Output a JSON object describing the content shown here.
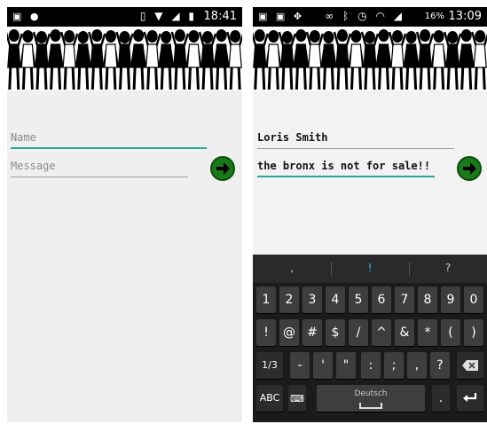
{
  "left_screen": {
    "status_time": "18:41",
    "name_placeholder": "Name",
    "message_placeholder": "Message"
  },
  "right_screen": {
    "status_time": "13:09",
    "battery_percent": "16%",
    "name_value": "Loris Smith",
    "message_value": "the bronx is not for sale!!"
  },
  "keyboard": {
    "suggestions": [
      ",",
      "!",
      "?"
    ],
    "row1": [
      "1",
      "2",
      "3",
      "4",
      "5",
      "6",
      "7",
      "8",
      "9",
      "0"
    ],
    "row2": [
      "!",
      "@",
      "#",
      "$",
      "/",
      "^",
      "&",
      "*",
      "(",
      ")"
    ],
    "row3": [
      "1/3",
      "-",
      "'",
      "\"",
      ":",
      ";",
      ",",
      "?"
    ],
    "row4_abc": "ABC",
    "row4_space": "Deutsch",
    "row4_dot": "."
  },
  "colors": {
    "accent_line": "#26a69a",
    "send_green": "#1a7a1a"
  },
  "icons": [
    "image-icon",
    "android-icon",
    "vibrate-icon",
    "wifi-icon",
    "signal-icon",
    "battery-icon",
    "alarm-icon",
    "bluetooth-icon",
    "dropbox-icon",
    "send-arrow-icon",
    "backspace-icon",
    "enter-icon",
    "emoji-icon"
  ]
}
